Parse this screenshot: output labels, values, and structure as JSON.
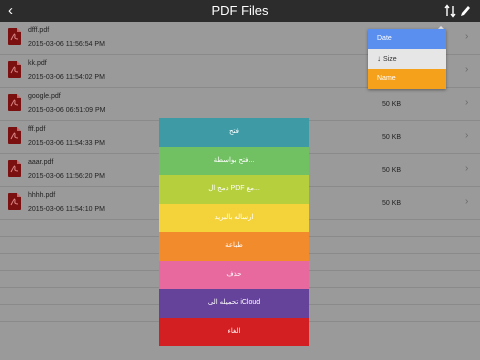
{
  "header": {
    "back_icon": "chevron-left-icon",
    "title": "PDF Files",
    "sort_icon": "sort-arrows-icon",
    "edit_icon": "pencil-icon"
  },
  "files": [
    {
      "name": "dfff.pdf",
      "date": "2015-03-06 11:56:54 PM",
      "size": ""
    },
    {
      "name": "kk.pdf",
      "date": "2015-03-06 11:54:02 PM",
      "size": ""
    },
    {
      "name": "google.pdf",
      "date": "2015-03-06 06:51:09 PM",
      "size": "50 KB"
    },
    {
      "name": "fff.pdf",
      "date": "2015-03-06 11:54:33 PM",
      "size": "50 KB"
    },
    {
      "name": "aaar.pdf",
      "date": "2015-03-06 11:56:20 PM",
      "size": "50 KB"
    },
    {
      "name": "hhhh.pdf",
      "date": "2015-03-06 11:54:10 PM",
      "size": "50 KB"
    }
  ],
  "sort_menu": {
    "date": "Date",
    "size": "Size",
    "name": "Name"
  },
  "actions": {
    "open": "فتح",
    "open_with": "فتح بواسطة...",
    "merge": "دمج ال PDF مع...",
    "email": "ارساله بالبريد",
    "print": "طباعة",
    "delete": "حذف",
    "icloud": "تحميله الى iCloud",
    "cancel": "الغاء"
  },
  "colors": {
    "open": "#3e9ba6",
    "open_with": "#71c062",
    "merge": "#b6cf3d",
    "email": "#f4d33a",
    "print": "#f28b2b",
    "delete": "#e8699e",
    "icloud": "#66439a",
    "cancel": "#d41f22"
  }
}
